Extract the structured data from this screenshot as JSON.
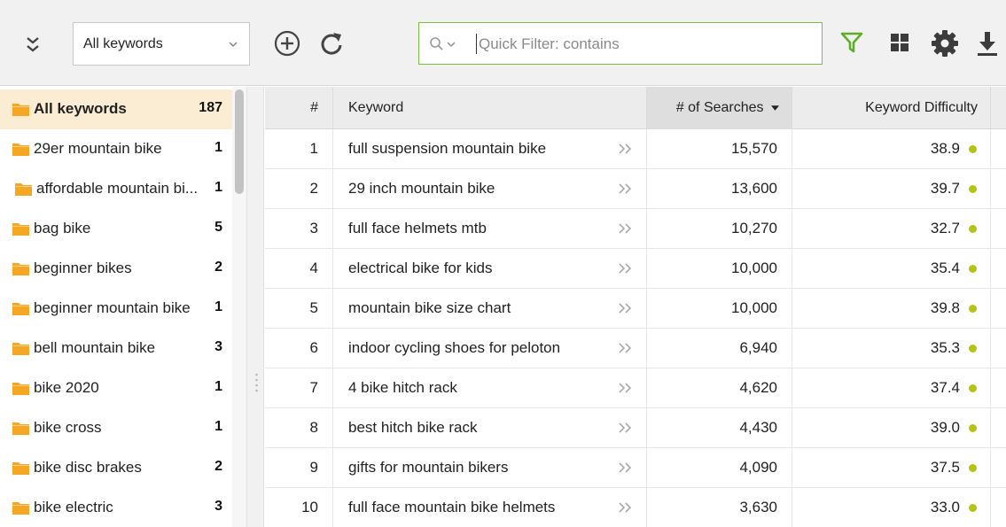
{
  "toolbar": {
    "collapse_icon": "double-chevron-down-icon",
    "dropdown_value": "All keywords",
    "add_icon": "plus-circle-icon",
    "refresh_icon": "refresh-icon",
    "filter_placeholder": "Quick Filter: contains",
    "filter_icon": "funnel-icon",
    "grid_icon": "grid-icon",
    "settings_icon": "gear-icon",
    "download_icon": "download-icon",
    "accent_color": "#7bbf42"
  },
  "sidebar": {
    "folder_color": "#f5a623",
    "items": [
      {
        "label": "All keywords",
        "count": "187",
        "selected": true
      },
      {
        "label": "29er mountain bike",
        "count": "1"
      },
      {
        "label": "affordable mountain bi...",
        "count": "1"
      },
      {
        "label": "bag bike",
        "count": "5"
      },
      {
        "label": "beginner bikes",
        "count": "2"
      },
      {
        "label": "beginner mountain bike",
        "count": "1"
      },
      {
        "label": "bell mountain bike",
        "count": "3"
      },
      {
        "label": "bike 2020",
        "count": "1"
      },
      {
        "label": "bike cross",
        "count": "1"
      },
      {
        "label": "bike disc brakes",
        "count": "2"
      },
      {
        "label": "bike electric",
        "count": "3"
      }
    ]
  },
  "table": {
    "columns": {
      "num": "#",
      "keyword": "Keyword",
      "searches": "# of Searches",
      "difficulty": "Keyword Difficulty"
    },
    "sorted_column": "searches",
    "difficulty_dot_color": "#b5c314",
    "rows": [
      {
        "num": "1",
        "keyword": "full suspension mountain bike",
        "searches": "15,570",
        "difficulty": "38.9"
      },
      {
        "num": "2",
        "keyword": "29 inch mountain bike",
        "searches": "13,600",
        "difficulty": "39.7"
      },
      {
        "num": "3",
        "keyword": "full face helmets mtb",
        "searches": "10,270",
        "difficulty": "32.7"
      },
      {
        "num": "4",
        "keyword": "electrical bike for kids",
        "searches": "10,000",
        "difficulty": "35.4"
      },
      {
        "num": "5",
        "keyword": "mountain bike size chart",
        "searches": "10,000",
        "difficulty": "39.8"
      },
      {
        "num": "6",
        "keyword": "indoor cycling shoes for peloton",
        "searches": "6,940",
        "difficulty": "35.3"
      },
      {
        "num": "7",
        "keyword": "4 bike hitch rack",
        "searches": "4,620",
        "difficulty": "37.4"
      },
      {
        "num": "8",
        "keyword": "best hitch bike rack",
        "searches": "4,430",
        "difficulty": "39.0"
      },
      {
        "num": "9",
        "keyword": "gifts for mountain bikers",
        "searches": "4,090",
        "difficulty": "37.5"
      },
      {
        "num": "10",
        "keyword": "full face mountain bike helmets",
        "searches": "3,630",
        "difficulty": "33.0"
      }
    ]
  }
}
